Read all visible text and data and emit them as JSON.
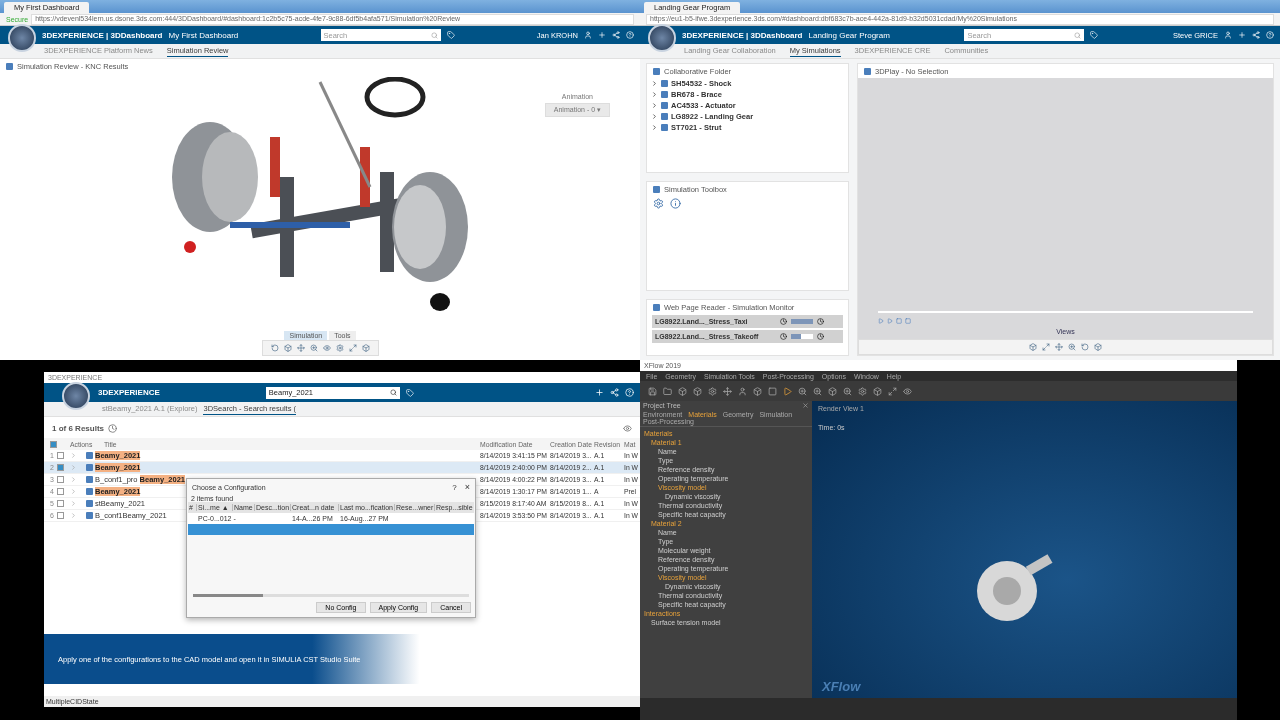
{
  "top_left": {
    "browser": {
      "tab": "My First Dashboard",
      "url": "https://vdevenl534lern.us.dsone.3ds.com:444/3DDashboard/#dashboard:1c2b5c75-acde-4fe7-9c88-6df5b4afa571/Simulation%20Review",
      "secure": "Secure"
    },
    "header": {
      "brand": "3DEXPERIENCE | 3DDashboard",
      "dashboard": "My First Dashboard",
      "search_placeholder": "Search",
      "user": "Jan KROHN"
    },
    "tabs": [
      {
        "label": "3DEXPERIENCE Platform News",
        "selected": false
      },
      {
        "label": "Simulation Review",
        "selected": true
      }
    ],
    "widget": {
      "title": "Simulation Review - KNC Results",
      "animation_label": "Animation",
      "animation_value": "Animation - 0 ▾",
      "viewer_tabs": [
        {
          "label": "Simulation",
          "selected": true
        },
        {
          "label": "Tools",
          "selected": false
        }
      ]
    }
  },
  "top_right": {
    "browser": {
      "tab": "Landing Gear Program",
      "url": "https://eu1-b5-ifwe.3dexperience.3ds.com/#dashboard:dbf683c7b-ace4-442a-81d9-b32d5031cdad/My%20Simulations"
    },
    "header": {
      "brand": "3DEXPERIENCE | 3DDashboard",
      "dashboard": "Landing Gear Program",
      "search_placeholder": "Search",
      "user": "Steve GRICE"
    },
    "tabs": [
      {
        "label": "Landing Gear Collaboration",
        "selected": false
      },
      {
        "label": "My Simulations",
        "selected": true
      },
      {
        "label": "3DEXPERIENCE CRE",
        "selected": false
      },
      {
        "label": "Communities",
        "selected": false
      }
    ],
    "folder": {
      "title": "Collaborative Folder",
      "items": [
        "SH54532 - Shock",
        "BR678 - Brace",
        "AC4533 - Actuator",
        "LG8922 - Landing Gear",
        "ST7021 - Strut"
      ]
    },
    "player": {
      "title": "3DPlay - No Selection",
      "views": "Views"
    },
    "toolbox": {
      "title": "Simulation Toolbox"
    },
    "monitor": {
      "title": "Web Page Reader - Simulation Monitor",
      "rows": [
        {
          "name": "LG8922.Land..._Stress_Taxi",
          "level": 1
        },
        {
          "name": "LG8922.Land..._Stress_Takeoff",
          "level": 0.45
        }
      ]
    }
  },
  "bottom_left": {
    "window_title": "3DEXPERIENCE",
    "brand": "3DEXPERIENCE",
    "search_value": "Beamy_2021",
    "tabs": [
      {
        "label": "stBeamy_2021 A.1 (Explore)",
        "selected": false
      },
      {
        "label": "3DSearch - Search results (",
        "selected": true
      }
    ],
    "results": "1 of 6 Results",
    "select_all": {
      "checked": true
    },
    "columns": [
      "Actions",
      "Title",
      "Modification Date",
      "Creation Date",
      "Revision",
      "Mat"
    ],
    "rows": [
      {
        "index": "1",
        "checked": false,
        "prefix": "",
        "title": "Beamy_2021",
        "highlighted": true,
        "modified": "8/14/2019 3:41:15 PM",
        "created": "8/14/2019 3...",
        "revision": "A.1",
        "maturity": "In W"
      },
      {
        "index": "2",
        "checked": true,
        "prefix": "",
        "title": "Beamy_2021",
        "highlighted": true,
        "modified": "8/14/2019 2:40:00 PM",
        "created": "8/14/2019 2...",
        "revision": "A.1",
        "maturity": "In W"
      },
      {
        "index": "3",
        "checked": false,
        "prefix": "B_conf1_pro",
        "title": "Beamy_2021",
        "highlighted": true,
        "modified": "8/14/2019 4:00:22 PM",
        "created": "8/14/2019 3...",
        "revision": "A.1",
        "maturity": "In W"
      },
      {
        "index": "4",
        "checked": false,
        "prefix": "",
        "title": "Beamy_2021",
        "highlighted": true,
        "modified": "8/14/2019 1:30:17 PM",
        "created": "8/14/2019 1...",
        "revision": "A",
        "maturity": "Prel"
      },
      {
        "index": "5",
        "checked": false,
        "prefix": "",
        "title": "stBeamy_2021",
        "highlighted": false,
        "modified": "8/15/2019 8:17:40 AM",
        "created": "8/15/2019 8...",
        "revision": "A.1",
        "maturity": "In W"
      },
      {
        "index": "6",
        "checked": false,
        "prefix": "",
        "title": "B_conf1Beamy_2021",
        "highlighted": false,
        "modified": "8/14/2019 3:53:50 PM",
        "created": "8/14/2019 3...",
        "revision": "A.1",
        "maturity": "In W"
      }
    ],
    "dialog": {
      "title": "Choose a Configuration",
      "help": "?",
      "close": "×",
      "count": "2 items found",
      "columns": [
        "#",
        "Si...me ▲",
        "Name",
        "Desc...tion",
        "Creat...n date",
        "Last mo...fication",
        "Rese...wner",
        "Resp...sible"
      ],
      "rows": [
        {
          "selected": false,
          "cells": [
            "",
            "PC-0...012 -",
            "",
            "",
            "14-A...26 PM",
            "16-Aug...27 PM",
            "",
            ""
          ]
        },
        {
          "selected": true,
          "cells": [
            "",
            "",
            "",
            "",
            "",
            "",
            "",
            ""
          ]
        }
      ],
      "buttons": [
        "No Config",
        "Apply Config",
        "Cancel"
      ]
    },
    "banner": "Apply one of the configurations to the CAD model and open it in SIMULIA CST Studio Suite",
    "status": "MultipleCIDState"
  },
  "bottom_right": {
    "window_title": "XFlow 2019",
    "menu": [
      "File",
      "Geometry",
      "Simulation Tools",
      "Post-Processing",
      "Options",
      "Window",
      "Help"
    ],
    "tree_title": "Project Tree",
    "tree_tabs": [
      {
        "label": "Environment",
        "selected": false
      },
      {
        "label": "Materials",
        "selected": true
      },
      {
        "label": "Geometry",
        "selected": false
      },
      {
        "label": "Simulation",
        "selected": false
      },
      {
        "label": "Post-Processing",
        "selected": false
      }
    ],
    "tree": [
      {
        "label": "Materials",
        "children": [
          {
            "label": "Material 1",
            "children": [
              {
                "label": "Name"
              },
              {
                "label": "Type"
              },
              {
                "label": "Reference density"
              },
              {
                "label": "Operating temperature"
              },
              {
                "label": "Viscosity model",
                "children": [
                  {
                    "label": "Dynamic viscosity"
                  }
                ]
              },
              {
                "label": "Thermal conductivity"
              },
              {
                "label": "Specific heat capacity"
              }
            ]
          },
          {
            "label": "Material 2",
            "children": [
              {
                "label": "Name"
              },
              {
                "label": "Type"
              },
              {
                "label": "Molecular weight"
              },
              {
                "label": "Reference density"
              },
              {
                "label": "Operating temperature"
              },
              {
                "label": "Viscosity model",
                "children": [
                  {
                    "label": "Dynamic viscosity"
                  }
                ]
              },
              {
                "label": "Thermal conductivity"
              },
              {
                "label": "Specific heat capacity"
              }
            ]
          }
        ]
      },
      {
        "label": "Interactions",
        "children": [
          {
            "label": "Surface tension model"
          }
        ]
      }
    ],
    "view_title": "Render View 1",
    "time": "Time: 0s",
    "logo": "XFlow"
  }
}
